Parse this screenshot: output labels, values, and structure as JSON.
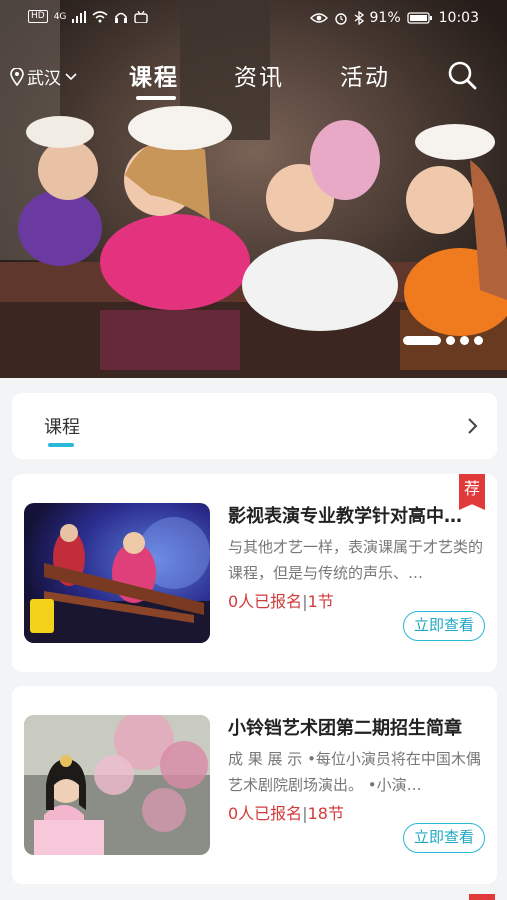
{
  "status_bar": {
    "hd": "HD",
    "network": "4G",
    "battery": "91%",
    "time": "10:03"
  },
  "nav": {
    "location": "武汉",
    "tabs": [
      {
        "label": "课程",
        "active": true
      },
      {
        "label": "资讯",
        "active": false
      },
      {
        "label": "活动",
        "active": false
      }
    ]
  },
  "banner": {
    "dots": 4,
    "active_dot": 1
  },
  "section": {
    "title": "课程"
  },
  "courses": [
    {
      "title": "影视表演专业教学针对高中…",
      "description": "与其他才艺一样，表演课属于才艺类的课程，但是与传统的声乐、…",
      "enrolled": "0人已报名",
      "separator": "|",
      "lessons": "1节",
      "button": "立即查看",
      "tag": "荐"
    },
    {
      "title": "小铃铛艺术团第二期招生简章",
      "description": "成 果 展 示 •每位小演员将在中国木偶艺术剧院剧场演出。 •小演…",
      "enrolled": "0人已报名",
      "separator": "|",
      "lessons": "18节",
      "button": "立即查看"
    }
  ],
  "colors": {
    "accent": "#2bb8d6",
    "red": "#d23b3b",
    "tag": "#e03a3a"
  }
}
